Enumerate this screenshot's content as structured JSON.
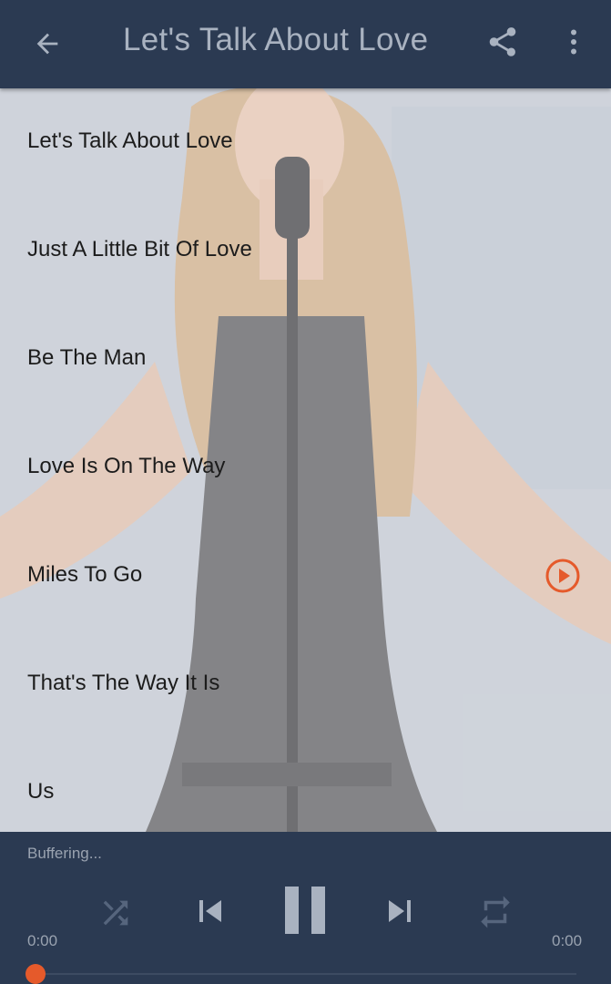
{
  "appbar": {
    "title": "Let's Talk About Love",
    "back_icon": "arrow-left-icon",
    "share_icon": "share-icon",
    "more_icon": "more-vert-icon"
  },
  "tracks": [
    {
      "title": "Let's Talk About Love",
      "playing": false
    },
    {
      "title": "Just A Little Bit Of Love",
      "playing": false
    },
    {
      "title": "Be The Man",
      "playing": false
    },
    {
      "title": "Love Is On The Way",
      "playing": false
    },
    {
      "title": "Miles To Go",
      "playing": true
    },
    {
      "title": "That's The Way It Is",
      "playing": false
    },
    {
      "title": "Us",
      "playing": false
    }
  ],
  "player": {
    "status": "Buffering...",
    "elapsed": "0:00",
    "duration": "0:00",
    "progress": 0,
    "controls": [
      "shuffle-icon",
      "skip-previous-icon",
      "pause-icon",
      "skip-next-icon",
      "repeat-icon"
    ]
  },
  "colors": {
    "appbar": "#2b3a52",
    "accent": "#e55a2b",
    "title_text": "#a9b2c0",
    "muted_text": "#9aa3b0"
  }
}
